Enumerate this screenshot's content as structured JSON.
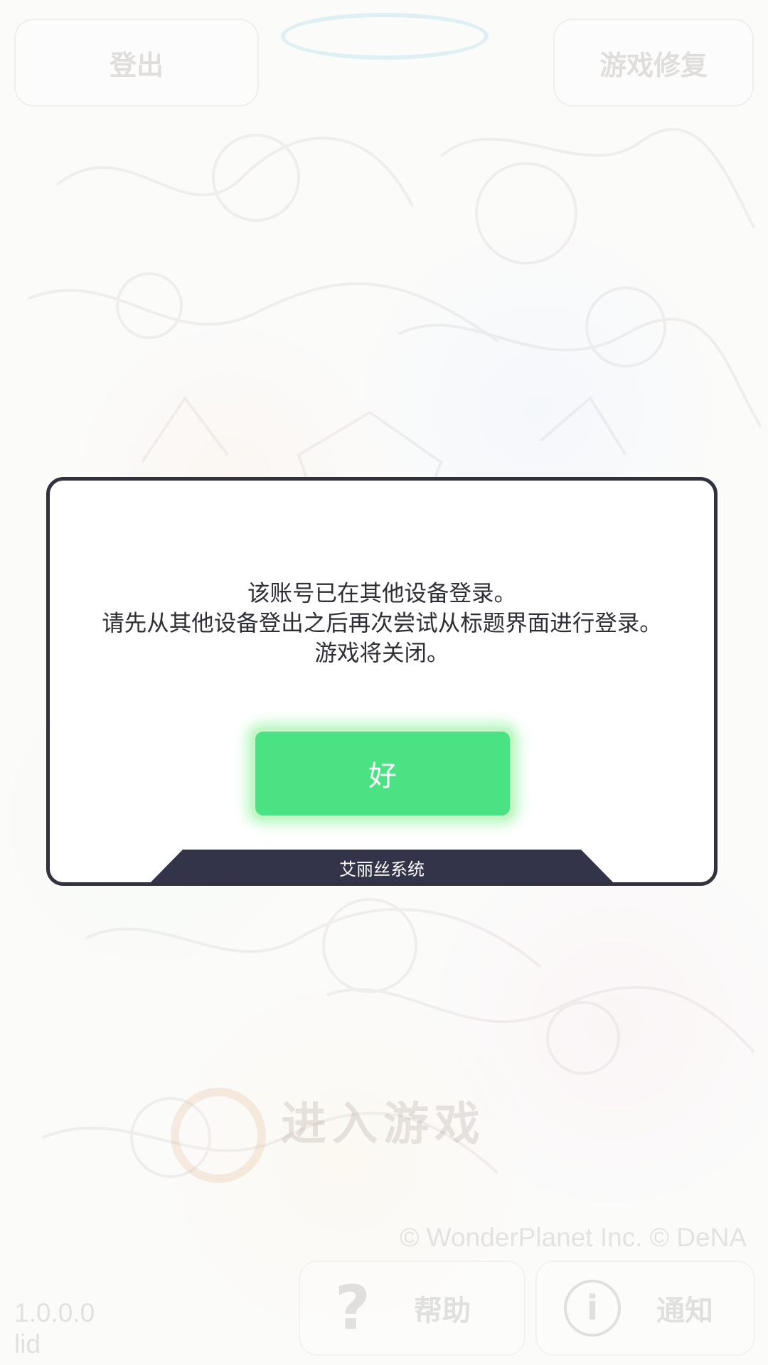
{
  "background": {
    "logout_label": "登出",
    "repair_label": "游戏修复",
    "enter_game_label": "进入游戏",
    "copyright": "© WonderPlanet Inc. © DeNA",
    "version_line1": "1.0.0.0",
    "version_line2": "lid",
    "help_label": "帮助",
    "help_icon_glyph": "?",
    "notice_label": "通知",
    "notice_icon_glyph": "i"
  },
  "dialog": {
    "message_lines": [
      "该账号已在其他设备登录。",
      "请先从其他设备登出之后再次尝试从标题界面进行登录。",
      "游戏将关闭。"
    ],
    "ok_label": "好",
    "footer_label": "艾丽丝系统"
  },
  "colors": {
    "dialog_border": "#32323f",
    "ok_button": "#4ae283",
    "ok_glow": "#c6f5c6",
    "footer_bar": "#33334a"
  },
  "icons": {
    "help": "question-mark-icon",
    "notice": "info-icon"
  }
}
